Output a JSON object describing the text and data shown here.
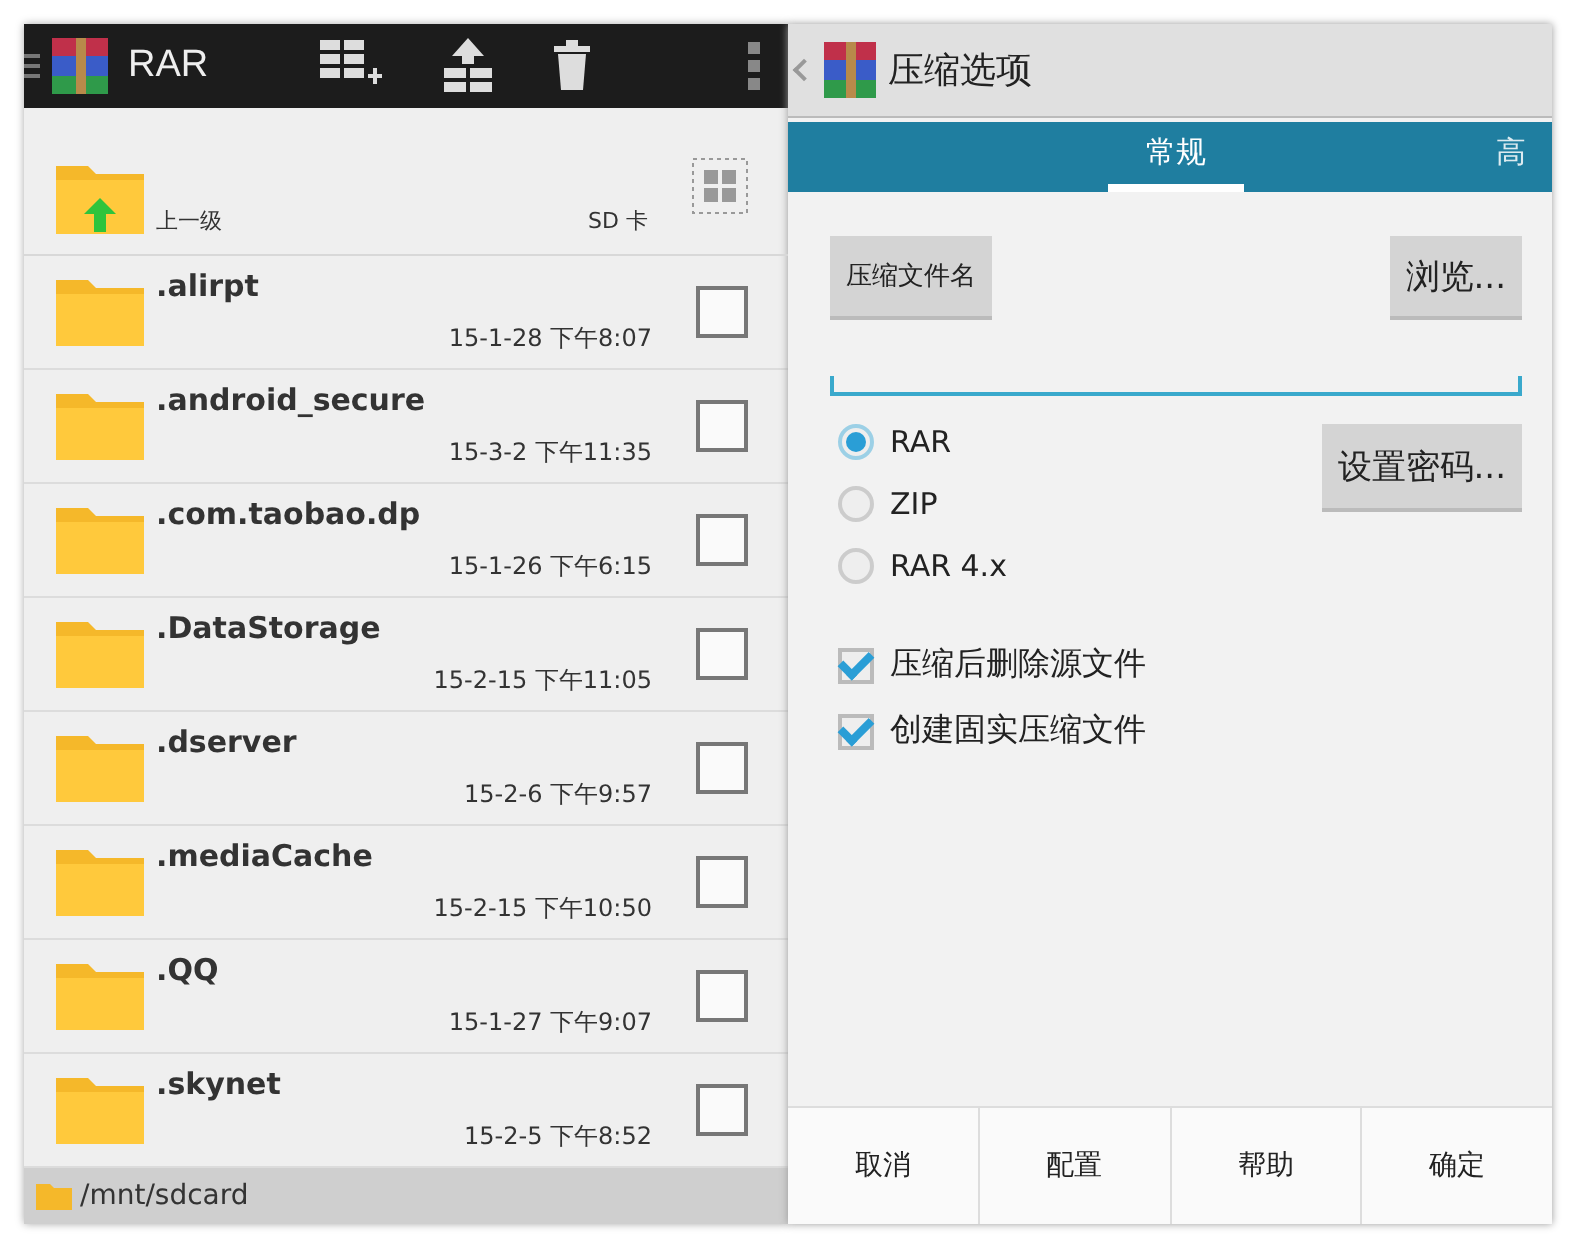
{
  "left": {
    "app_bar": {
      "title": "RAR"
    },
    "header": {
      "up_label": "上一级",
      "storage": "SD 卡"
    },
    "files": [
      {
        "name": ".alirpt",
        "date": "15-1-28 下午8:07",
        "checked": false
      },
      {
        "name": ".android_secure",
        "date": "15-3-2 下午11:35",
        "checked": false
      },
      {
        "name": ".com.taobao.dp",
        "date": "15-1-26 下午6:15",
        "checked": false
      },
      {
        "name": ".DataStorage",
        "date": "15-2-15 下午11:05",
        "checked": false
      },
      {
        "name": ".dserver",
        "date": "15-2-6 下午9:57",
        "checked": false
      },
      {
        "name": ".mediaCache",
        "date": "15-2-15 下午10:50",
        "checked": false
      },
      {
        "name": ".QQ",
        "date": "15-1-27 下午9:07",
        "checked": false
      },
      {
        "name": ".skynet",
        "date": "15-2-5 下午8:52",
        "checked": false
      }
    ],
    "path": "/mnt/sdcard"
  },
  "right": {
    "title": "压缩选项",
    "tabs": [
      {
        "label": "常规",
        "selected": true
      },
      {
        "label": "高",
        "selected": false
      }
    ],
    "archive_name_button": "压缩文件名",
    "browse_button": "浏览...",
    "password_button": "设置密码...",
    "formats": [
      {
        "label": "RAR",
        "selected": true
      },
      {
        "label": "ZIP",
        "selected": false
      },
      {
        "label": "RAR 4.x",
        "selected": false
      }
    ],
    "options": [
      {
        "label": "压缩后删除源文件",
        "checked": true
      },
      {
        "label": "创建固实压缩文件",
        "checked": true
      }
    ],
    "buttons": [
      "取消",
      "配置",
      "帮助",
      "确定"
    ]
  }
}
